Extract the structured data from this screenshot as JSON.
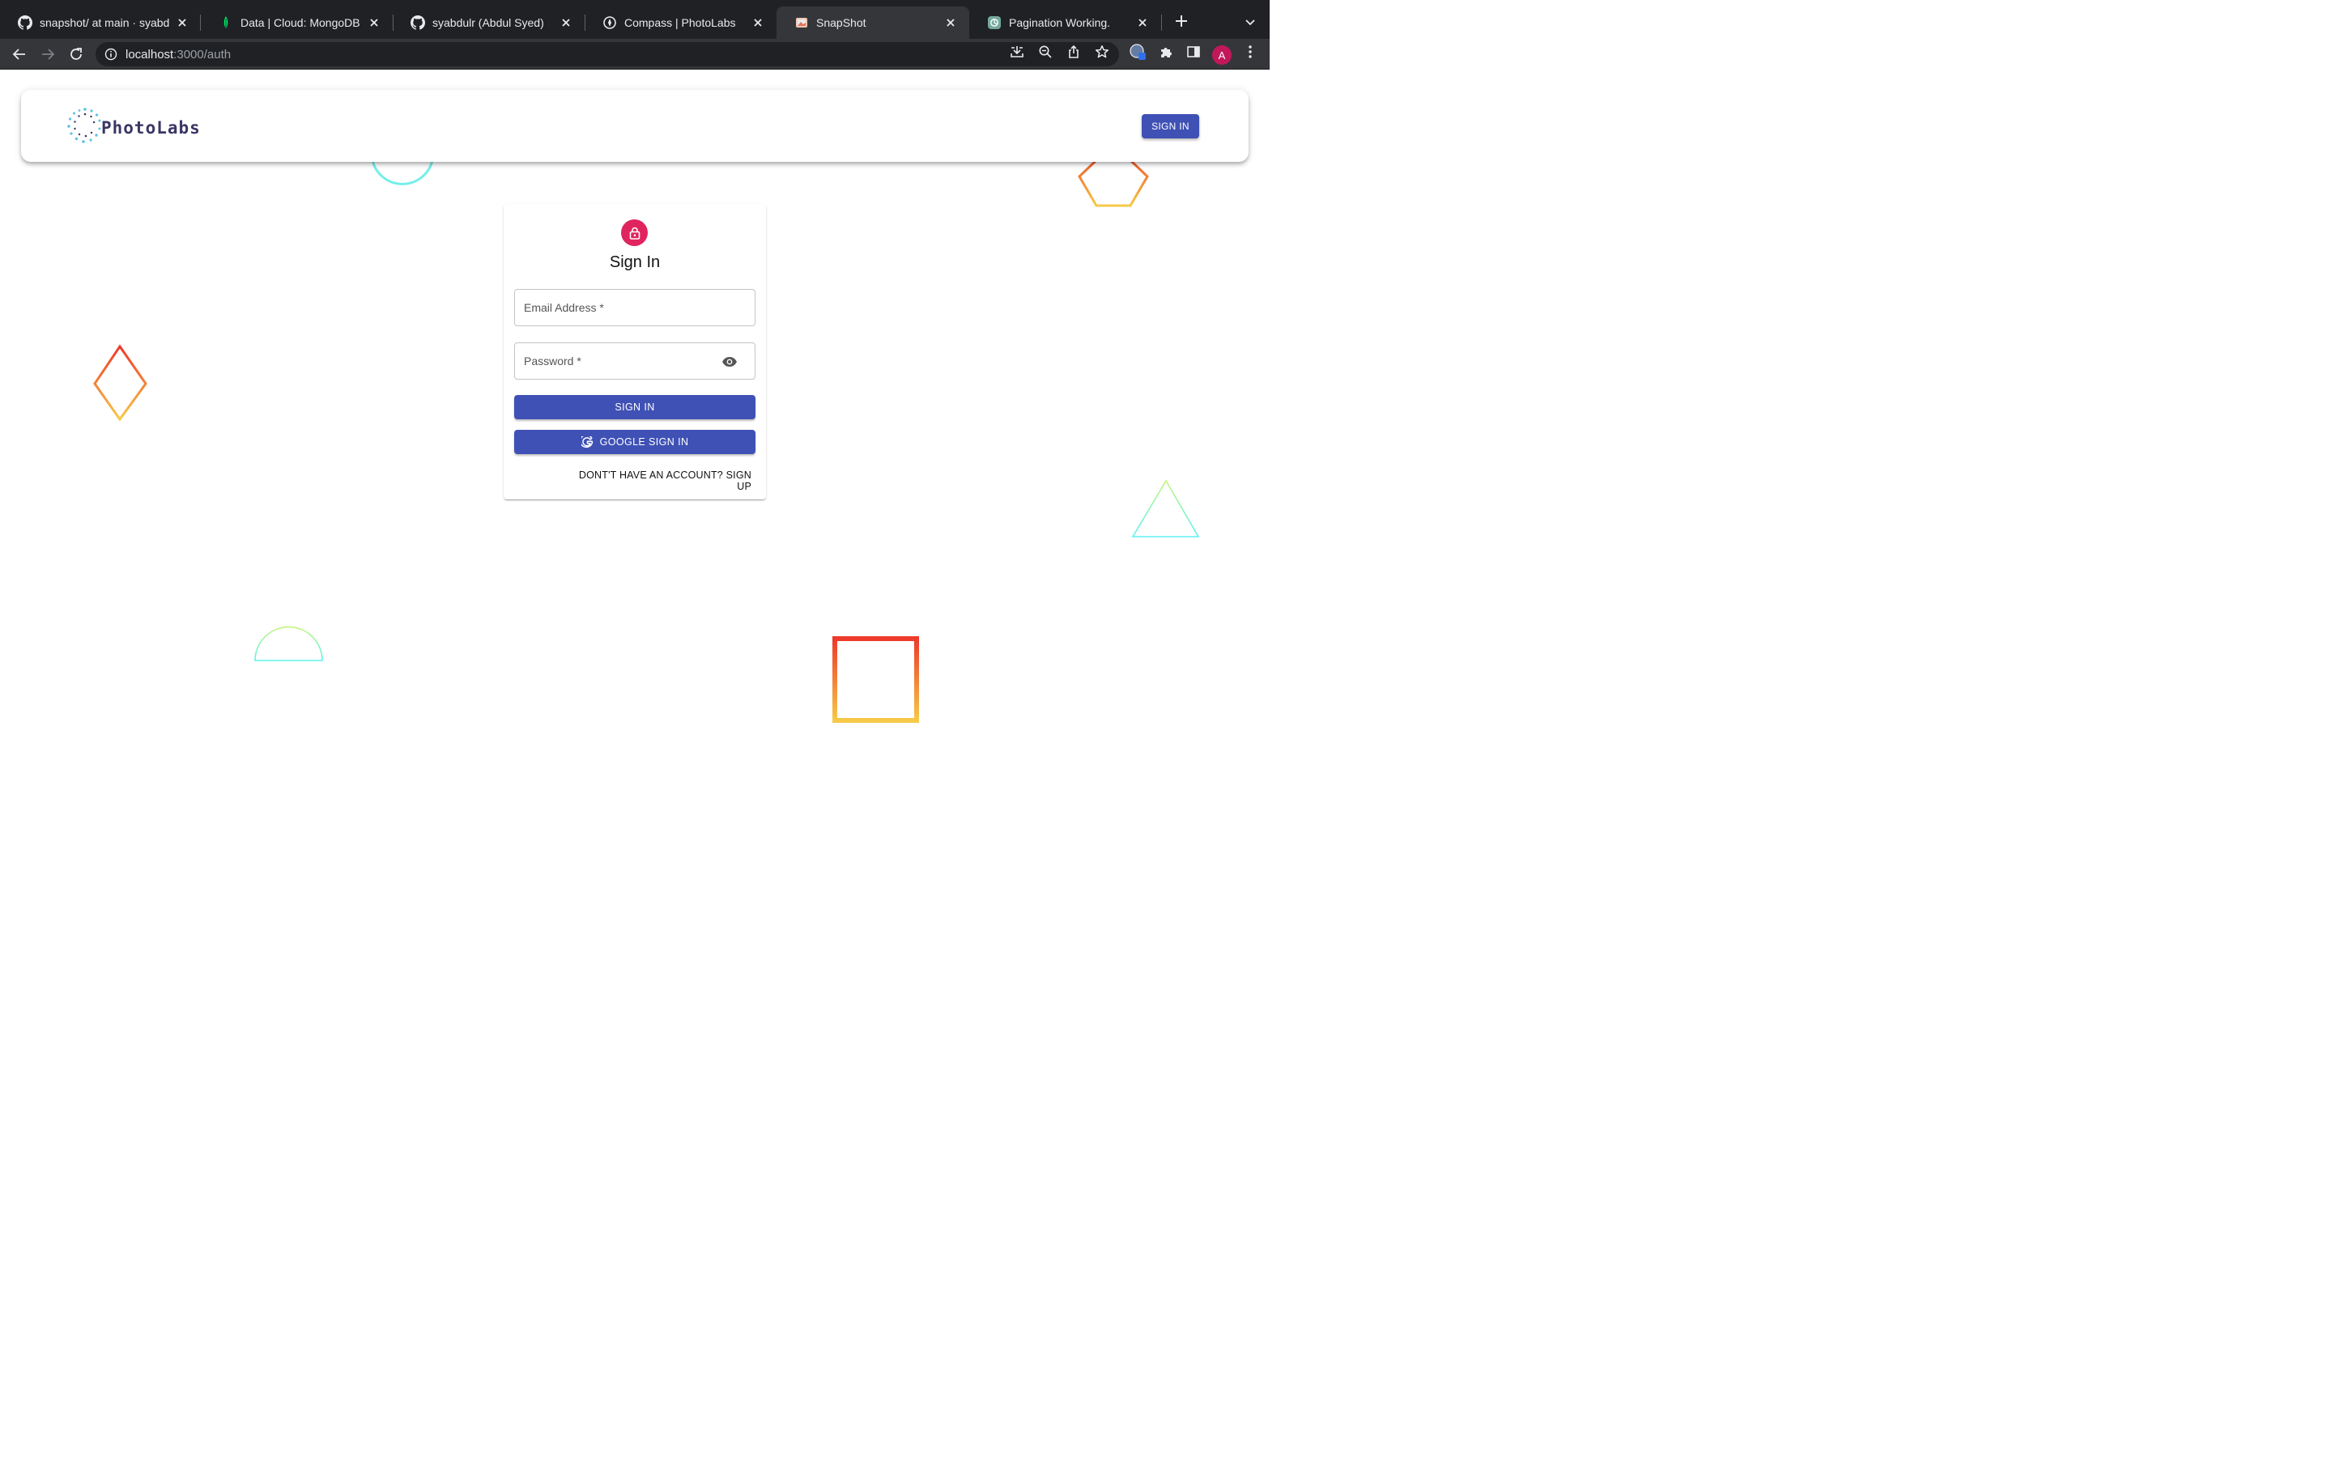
{
  "browser": {
    "tabs": [
      {
        "title": "snapshot/ at main · syabdulr",
        "icon": "github-icon",
        "active": false
      },
      {
        "title": "Data | Cloud: MongoDB Cloud",
        "icon": "mongodb-leaf-icon",
        "active": false
      },
      {
        "title": "syabdulr (Abdul Syed)",
        "icon": "github-icon",
        "active": false
      },
      {
        "title": "Compass | PhotoLabs",
        "icon": "compass-icon",
        "active": false
      },
      {
        "title": "SnapShot",
        "icon": "snapshot-favicon-icon",
        "active": true
      },
      {
        "title": "Pagination Working.",
        "icon": "chatgpt-icon",
        "active": false
      }
    ],
    "address": {
      "host": "localhost",
      "rest": ":3000/auth"
    },
    "profile_initial": "A"
  },
  "app": {
    "brand": "PhotoLabs",
    "header_button": "SIGN IN"
  },
  "auth": {
    "title": "Sign In",
    "email_label": "Email Address",
    "password_label": "Password",
    "required_mark": "*",
    "submit_label": "SIGN IN",
    "google_label": "GOOGLE SIGN IN",
    "switch_label": "DONT'T HAVE AN ACCOUNT? SIGN UP"
  },
  "colors": {
    "primary": "#3f51b5",
    "avatar_accent": "#e0245e",
    "brand_text": "#3a3665",
    "shape_warm_start": "#ee3a2a",
    "shape_warm_end": "#f7c948",
    "shape_cool_start": "#c4f57a",
    "shape_cool_end": "#5ef2f2"
  }
}
